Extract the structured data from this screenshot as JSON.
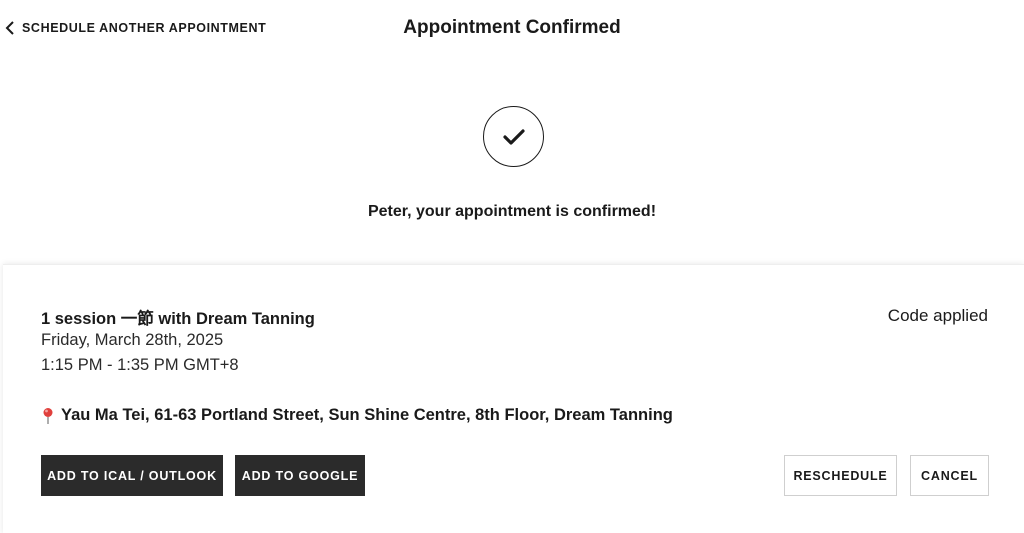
{
  "header": {
    "back_label": "SCHEDULE ANOTHER APPOINTMENT",
    "title": "Appointment Confirmed"
  },
  "confirmation": {
    "message": "Peter, your appointment is confirmed!"
  },
  "appointment": {
    "service": "1 session 一節 with Dream Tanning",
    "date": "Friday, March 28th, 2025",
    "time": "1:15 PM - 1:35 PM GMT+8",
    "code_status": "Code applied",
    "location": "Yau Ma Tei, 61-63 Portland Street, Sun Shine Centre, 8th Floor, Dream Tanning"
  },
  "actions": {
    "ical": "ADD TO ICAL / OUTLOOK",
    "google": "ADD TO GOOGLE",
    "reschedule": "RESCHEDULE",
    "cancel": "CANCEL"
  },
  "icons": {
    "back": "chevron-left-icon",
    "check": "checkmark-icon",
    "pin": "map-pin-icon"
  },
  "colors": {
    "dark_button": "#2b2b2b",
    "pin": "#e0403c"
  }
}
